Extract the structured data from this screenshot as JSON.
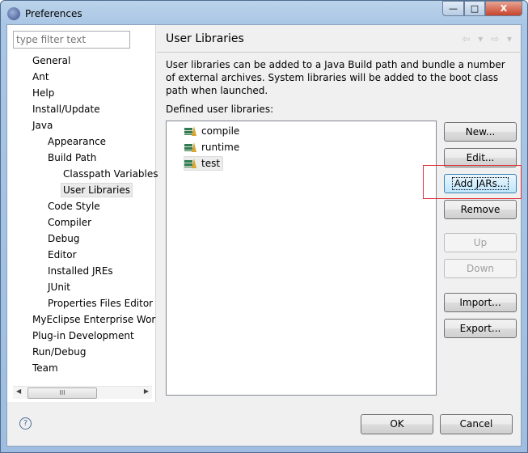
{
  "window": {
    "title": "Preferences",
    "controls": {
      "minimize": "—",
      "maximize": "□",
      "close": "X"
    }
  },
  "sidebar": {
    "filter_placeholder": "type filter text",
    "items": [
      {
        "label": "General",
        "level": 0
      },
      {
        "label": "Ant",
        "level": 0
      },
      {
        "label": "Help",
        "level": 0
      },
      {
        "label": "Install/Update",
        "level": 0
      },
      {
        "label": "Java",
        "level": 0
      },
      {
        "label": "Appearance",
        "level": 1
      },
      {
        "label": "Build Path",
        "level": 1
      },
      {
        "label": "Classpath Variables",
        "level": 2
      },
      {
        "label": "User Libraries",
        "level": 2,
        "selected": true
      },
      {
        "label": "Code Style",
        "level": 1
      },
      {
        "label": "Compiler",
        "level": 1
      },
      {
        "label": "Debug",
        "level": 1
      },
      {
        "label": "Editor",
        "level": 1
      },
      {
        "label": "Installed JREs",
        "level": 1
      },
      {
        "label": "JUnit",
        "level": 1
      },
      {
        "label": "Properties Files Editor",
        "level": 1
      },
      {
        "label": "MyEclipse Enterprise Wor",
        "level": 0
      },
      {
        "label": "Plug-in Development",
        "level": 0
      },
      {
        "label": "Run/Debug",
        "level": 0
      },
      {
        "label": "Team",
        "level": 0
      }
    ],
    "scroll_thumb": "III"
  },
  "page": {
    "title": "User Libraries",
    "nav": "⇦ ▾ ⇨ ▾",
    "description": "User libraries can be added to a Java Build path and bundle a number of external archives. System libraries will be added to the boot class path when launched.",
    "defined_label": "Defined user libraries:",
    "libraries": [
      {
        "name": "compile"
      },
      {
        "name": "runtime"
      },
      {
        "name": "test",
        "selected": true
      }
    ],
    "buttons": {
      "new": "New...",
      "edit": "Edit...",
      "add_jars": "Add JARs...",
      "remove": "Remove",
      "up": "Up",
      "down": "Down",
      "import": "Import...",
      "export": "Export..."
    }
  },
  "footer": {
    "help": "?",
    "ok": "OK",
    "cancel": "Cancel"
  },
  "colors": {
    "highlight_box": "#e0303a"
  }
}
